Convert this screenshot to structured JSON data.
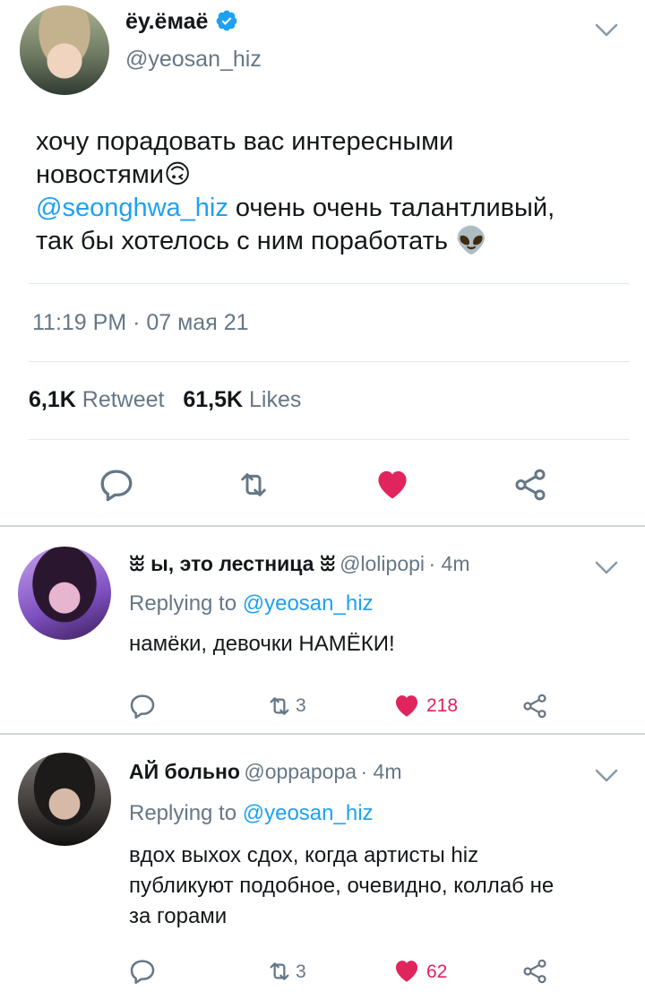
{
  "main_tweet": {
    "display_name": "ёу.ёмаё",
    "handle": "@yeosan_hiz",
    "text_line1": "хочу порадовать вас интересными",
    "text_line2": "новостями",
    "emoji1": "🙃",
    "mention": "@seonghwa_hiz",
    "text_line3_rest": " очень очень талантливый,",
    "text_line4": "так бы хотелось с ним поработать ",
    "emoji2": "👽",
    "timestamp": "11:19 PM · 07 мая 21",
    "retweets_count": "6,1K",
    "retweets_label": "Retweet",
    "likes_count": "61,5K",
    "likes_label": "Likes"
  },
  "replies": [
    {
      "display_name": "ꖿ ы, это лестница ꖿ",
      "handle": "@lolipopi",
      "time": "· 4m",
      "replying_prefix": "Replying to ",
      "replying_handle": "@yeosan_hiz",
      "text_line1": "намёки, девочки НАМЁКИ!",
      "retweets": "3",
      "likes": "218"
    },
    {
      "display_name": "АЙ больно",
      "handle": "@oppapopa",
      "time": "· 4m",
      "replying_prefix": "Replying to ",
      "replying_handle": "@yeosan_hiz",
      "text_line1": "вдох выхох сдох, когда артисты hiz",
      "text_line2": "публикуют подобное, очевидно, коллаб не",
      "text_line3": "за горами",
      "retweets": "3",
      "likes": "62"
    }
  ],
  "colors": {
    "accent": "#1da1f2",
    "like_red": "#e0245e",
    "muted": "#657786",
    "divider": "#e1e8ed"
  },
  "icons": [
    "verified-badge-icon",
    "chevron-down-icon",
    "reply-icon",
    "retweet-icon",
    "heart-icon",
    "share-icon"
  ]
}
